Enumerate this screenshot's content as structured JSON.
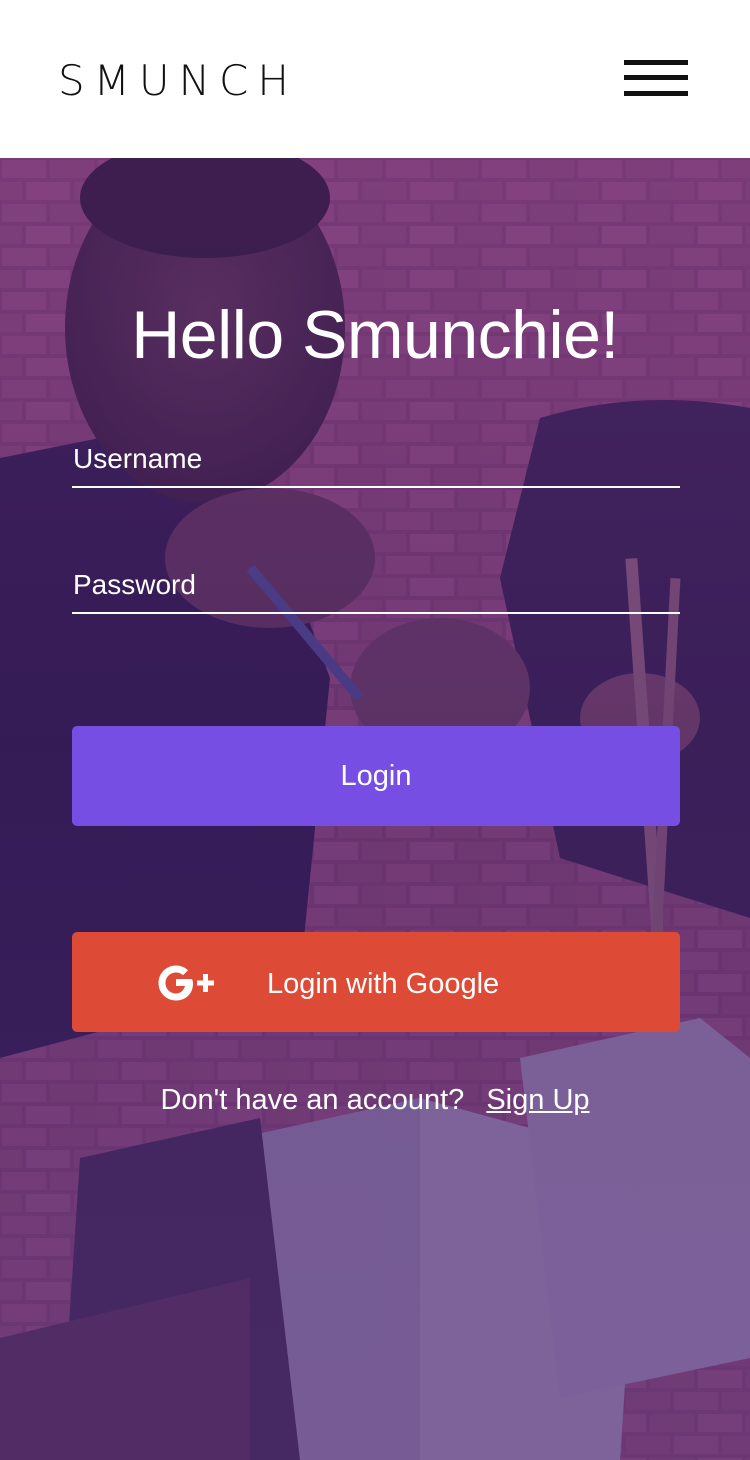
{
  "header": {
    "logo": "SMUNCH",
    "menu_icon": "hamburger-menu-icon"
  },
  "main": {
    "title": "Hello Smunchie!",
    "username_placeholder": "Username",
    "password_placeholder": "Password",
    "login_label": "Login",
    "google_icon": "google-plus-icon",
    "google_login_label": "Login with Google",
    "signup_prompt": "Don't have an account?",
    "signup_link": "Sign Up"
  },
  "colors": {
    "header_bg": "#ffffff",
    "login_button": "#764ee3",
    "google_button": "#dd4b36",
    "overlay": "#5c2c7c",
    "text_on_hero": "#ffffff"
  }
}
